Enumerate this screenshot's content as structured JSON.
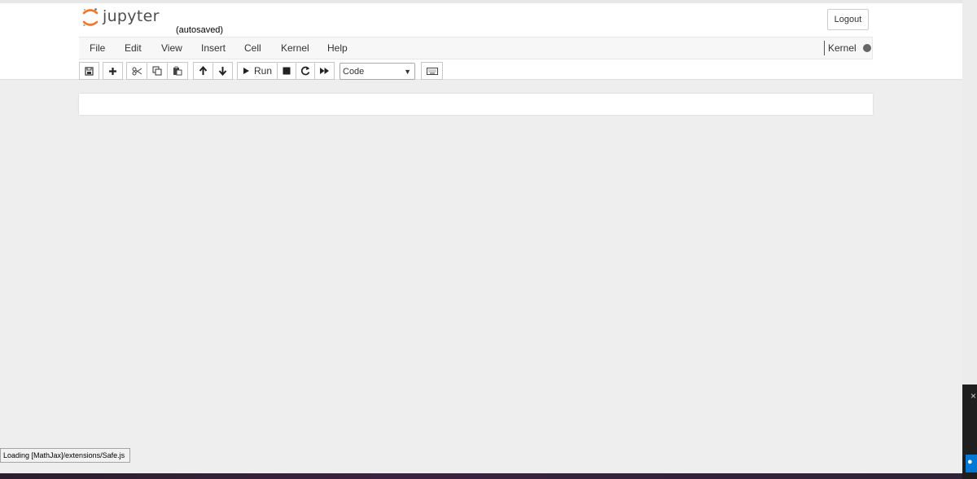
{
  "header": {
    "logo_text": "jupyter",
    "save_status": "(autosaved)",
    "logout_label": "Logout"
  },
  "menubar": {
    "items": [
      {
        "label": "File"
      },
      {
        "label": "Edit"
      },
      {
        "label": "View"
      },
      {
        "label": "Insert"
      },
      {
        "label": "Cell"
      },
      {
        "label": "Kernel"
      },
      {
        "label": "Help"
      }
    ],
    "kernel_indicator_label": "Kernel"
  },
  "toolbar": {
    "buttons": [
      {
        "name": "save-icon"
      },
      {
        "name": "plus-icon"
      },
      {
        "name": "scissors-icon"
      },
      {
        "name": "copy-icon"
      },
      {
        "name": "paste-icon"
      },
      {
        "name": "arrow-up-icon"
      },
      {
        "name": "arrow-down-icon"
      },
      {
        "name": "play-icon"
      },
      {
        "name": "stop-icon"
      },
      {
        "name": "restart-icon"
      },
      {
        "name": "fast-forward-icon"
      },
      {
        "name": "keyboard-icon"
      }
    ],
    "run_label": "Run",
    "cell_type_selected": "Code"
  },
  "status": {
    "loading_message": "Loading [MathJax]/extensions/Safe.js"
  },
  "colors": {
    "logo_orange": "#f37726",
    "page_background": "#eeeeee",
    "windows_blue": "#0078d4"
  }
}
